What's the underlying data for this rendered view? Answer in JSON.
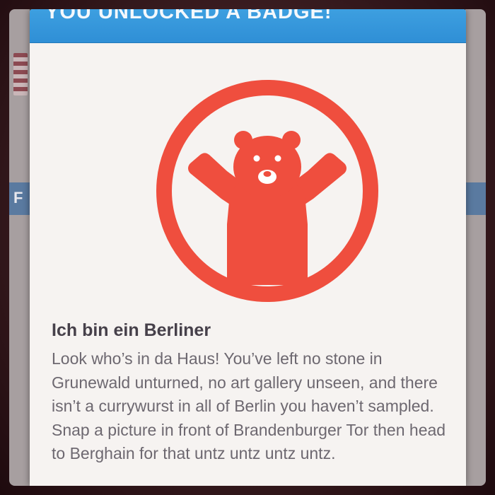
{
  "dialog": {
    "title": "YOU UNLOCKED A BADGE!",
    "badge": {
      "icon": "berlin-bear-icon",
      "icon_color": "#ef4e3e",
      "name": "Ich bin ein Berliner",
      "description": "Look who’s in da Haus! You’ve left no stone in Grunewald unturned, no art gallery unseen, and there isn’t a currywurst in all of Berlin you haven’t sampled. Snap a picture in front of Brandenburger Tor then head to Berghain for that untz untz untz untz."
    }
  },
  "background_app": {
    "header_color": "#5a7aa0",
    "visible_letter": "F"
  }
}
